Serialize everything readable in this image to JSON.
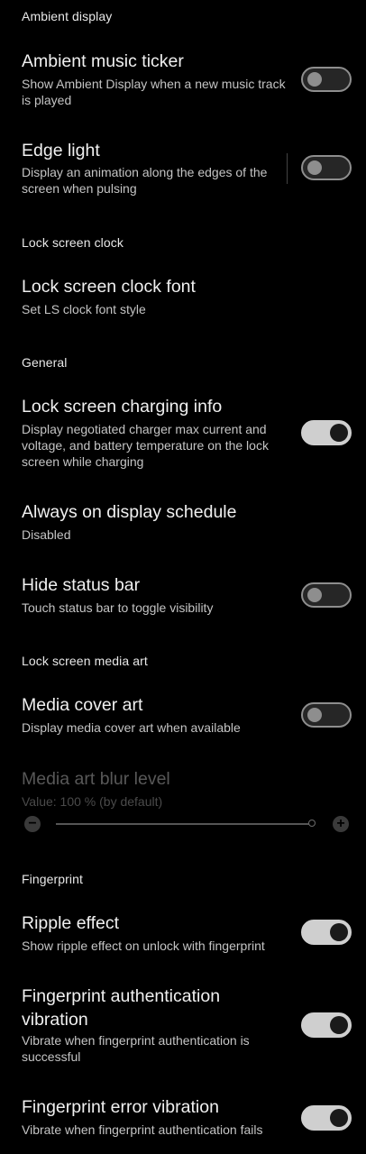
{
  "sections": {
    "ambient": {
      "header": "Ambient display"
    },
    "lockclock": {
      "header": "Lock screen clock"
    },
    "general": {
      "header": "General"
    },
    "mediaart": {
      "header": "Lock screen media art"
    },
    "fingerprint": {
      "header": "Fingerprint"
    }
  },
  "items": {
    "ambient_music_ticker": {
      "title": "Ambient music ticker",
      "summary": "Show Ambient Display when a new music track is played",
      "state": "off"
    },
    "edge_light": {
      "title": "Edge light",
      "summary": "Display an animation along the edges of the screen when pulsing",
      "state": "off"
    },
    "lock_screen_clock_font": {
      "title": "Lock screen clock font",
      "summary": "Set LS clock font style"
    },
    "lock_screen_charging_info": {
      "title": "Lock screen charging info",
      "summary": "Display negotiated charger max current and voltage, and battery temperature on the lock screen while charging",
      "state": "on"
    },
    "aod_schedule": {
      "title": "Always on display schedule",
      "summary": "Disabled"
    },
    "hide_status_bar": {
      "title": "Hide status bar",
      "summary": "Touch status bar to toggle visibility",
      "state": "off"
    },
    "media_cover_art": {
      "title": "Media cover art",
      "summary": "Display media cover art when available",
      "state": "off"
    },
    "media_art_blur": {
      "title": "Media art blur level",
      "summary": "Value: 100 % (by default)",
      "minus_glyph": "−",
      "plus_glyph": "+",
      "value_percent": 100,
      "enabled": false
    },
    "ripple_effect": {
      "title": "Ripple effect",
      "summary": "Show ripple effect on unlock with fingerprint",
      "state": "on"
    },
    "fp_auth_vibration": {
      "title": "Fingerprint authentication vibration",
      "summary": "Vibrate when fingerprint authentication is successful",
      "state": "on"
    },
    "fp_error_vibration": {
      "title": "Fingerprint error vibration",
      "summary": "Vibrate when fingerprint authentication fails",
      "state": "on"
    }
  },
  "icons": {
    "minus": "minus-circle-icon",
    "plus": "plus-circle-icon"
  },
  "colors": {
    "background": "#000000",
    "switch_on": "#cfcfcf",
    "switch_off_border": "#8e8e8e"
  }
}
